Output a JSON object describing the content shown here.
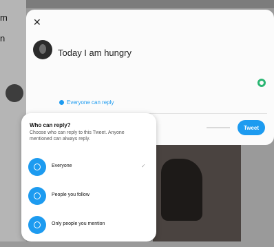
{
  "background": {
    "side_text_1": "m",
    "side_text_2": "n"
  },
  "compose": {
    "close_icon": "close-icon",
    "text": "Today I am hungry",
    "reply_setting": "Everyone can reply",
    "tweet_label": "Tweet",
    "colors": {
      "accent": "#1d9bf0",
      "counter": "#2bb673"
    }
  },
  "reply_menu": {
    "title": "Who can reply?",
    "description": "Choose who can reply to this Tweet. Anyone mentioned can always reply.",
    "options": [
      {
        "label": "Everyone",
        "icon": "globe-icon",
        "selected": true
      },
      {
        "label": "People you follow",
        "icon": "people-icon",
        "selected": false
      },
      {
        "label": "Only people you mention",
        "icon": "mention-icon",
        "selected": false
      }
    ]
  }
}
